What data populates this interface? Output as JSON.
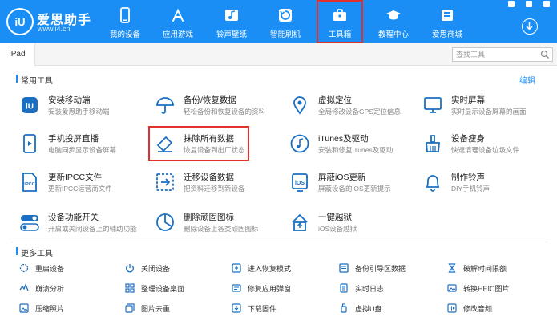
{
  "app": {
    "name": "爱思助手",
    "url": "www.i4.cn"
  },
  "nav": [
    {
      "label": "我的设备",
      "icon": "phone-icon"
    },
    {
      "label": "应用游戏",
      "icon": "app-store-icon"
    },
    {
      "label": "铃声壁纸",
      "icon": "music-wallpaper-icon"
    },
    {
      "label": "智能刷机",
      "icon": "flash-icon"
    },
    {
      "label": "工具箱",
      "icon": "toolbox-icon",
      "active": true
    },
    {
      "label": "教程中心",
      "icon": "graduation-cap-icon"
    },
    {
      "label": "爱思商城",
      "icon": "shop-icon"
    }
  ],
  "tabs": {
    "device_tab": "iPad"
  },
  "search": {
    "placeholder": "查找工具"
  },
  "common_tools": {
    "title": "常用工具",
    "edit": "编辑",
    "items": [
      {
        "name": "安装移动端",
        "desc": "安装爱思助手移动端",
        "icon": "i4-mobile-icon"
      },
      {
        "name": "备份/恢复数据",
        "desc": "轻松备份和恢复设备的资料",
        "icon": "umbrella-icon"
      },
      {
        "name": "虚拟定位",
        "desc": "全局修改设备GPS定位信息",
        "icon": "location-pin-icon"
      },
      {
        "name": "实时屏幕",
        "desc": "实时显示设备屏幕的画面",
        "icon": "monitor-icon"
      },
      {
        "name": "手机投屏直播",
        "desc": "电脑同步显示设备屏幕",
        "icon": "screen-cast-icon"
      },
      {
        "name": "抹除所有数据",
        "desc": "恢复设备到出厂状态",
        "icon": "eraser-icon",
        "highlighted": true
      },
      {
        "name": "iTunes及驱动",
        "desc": "安装和修复iTunes及驱动",
        "icon": "itunes-icon"
      },
      {
        "name": "设备瘦身",
        "desc": "快速清理设备垃圾文件",
        "icon": "broom-icon"
      },
      {
        "name": "更新IPCC文件",
        "desc": "更新IPCC运营商文件",
        "icon": "ipcc-file-icon"
      },
      {
        "name": "迁移设备数据",
        "desc": "把资料迁移到新设备",
        "icon": "migrate-icon"
      },
      {
        "name": "屏蔽iOS更新",
        "desc": "屏蔽设备的iOS更新提示",
        "icon": "block-update-icon"
      },
      {
        "name": "制作铃声",
        "desc": "DIY手机铃声",
        "icon": "bell-icon"
      },
      {
        "name": "设备功能开关",
        "desc": "开启或关闭设备上的辅助功能",
        "icon": "toggle-icon"
      },
      {
        "name": "删除顽固图标",
        "desc": "删除设备上各类顽固图标",
        "icon": "pie-icon"
      },
      {
        "name": "一键越狱",
        "desc": "iOS设备越狱",
        "icon": "jailbreak-icon"
      }
    ]
  },
  "more_tools": {
    "title": "更多工具",
    "items": [
      {
        "label": "重启设备",
        "icon": "restart-icon"
      },
      {
        "label": "关闭设备",
        "icon": "power-icon"
      },
      {
        "label": "进入恢复模式",
        "icon": "recovery-icon"
      },
      {
        "label": "备份引导区数据",
        "icon": "backup-boot-icon"
      },
      {
        "label": "破解时间限额",
        "icon": "hourglass-icon"
      },
      {
        "label": "崩溃分析",
        "icon": "crash-icon"
      },
      {
        "label": "整理设备桌面",
        "icon": "grid-icon"
      },
      {
        "label": "修复应用弹窗",
        "icon": "repair-popup-icon"
      },
      {
        "label": "实时日志",
        "icon": "log-icon"
      },
      {
        "label": "转换HEIC图片",
        "icon": "heic-icon"
      },
      {
        "label": "压缩照片",
        "icon": "compress-photo-icon"
      },
      {
        "label": "图片去重",
        "icon": "dedupe-photo-icon"
      },
      {
        "label": "下载固件",
        "icon": "download-firmware-icon"
      },
      {
        "label": "虚拟U盘",
        "icon": "usb-drive-icon"
      },
      {
        "label": "修改音频",
        "icon": "audio-edit-icon"
      }
    ]
  },
  "colors": {
    "brand": "#1a8ef5",
    "highlight": "#e0312d",
    "icon": "#1b6fc2"
  }
}
